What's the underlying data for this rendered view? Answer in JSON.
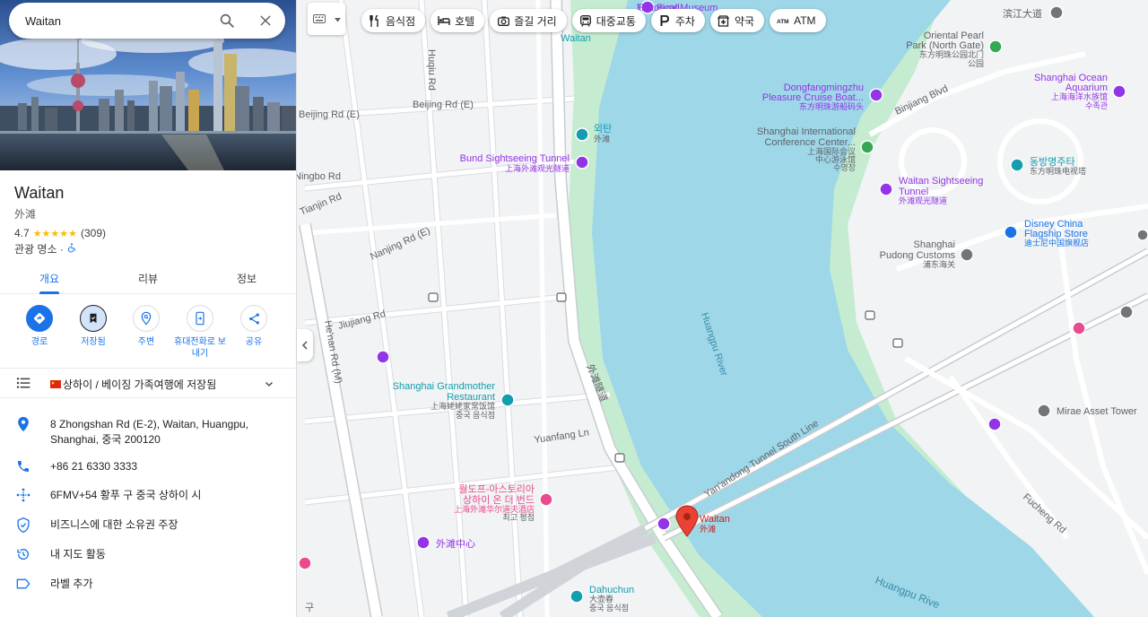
{
  "search": {
    "value": "Waitan"
  },
  "place": {
    "name": "Waitan",
    "local_name": "外滩",
    "rating": "4.7",
    "stars": "★★★★★",
    "review_count": "(309)",
    "category": "관광 명소 ·"
  },
  "tabs": [
    {
      "label": "개요"
    },
    {
      "label": "리뷰"
    },
    {
      "label": "정보"
    }
  ],
  "actions": [
    {
      "label": "경로"
    },
    {
      "label": "저장됨"
    },
    {
      "label": "주변"
    },
    {
      "label": "휴대전화로 보내기"
    },
    {
      "label": "공유"
    }
  ],
  "saved_list": {
    "label": "상하이 / 베이징 가족여행에 저장됨"
  },
  "info": {
    "address": "8 Zhongshan Rd (E-2), Waitan, Huangpu, Shanghai, 중국 200120",
    "phone": "+86 21 6330 3333",
    "plus_code": "6FMV+54 황푸 구 중국 상하이 시",
    "claim": "비즈니스에 대한 소유권 주장",
    "activity": "내 지도 활동",
    "label": "라벨 추가"
  },
  "chips": [
    {
      "label": "음식점",
      "icon": "restaurant-icon"
    },
    {
      "label": "호텔",
      "icon": "hotel-icon"
    },
    {
      "label": "즐길 거리",
      "icon": "camera-icon"
    },
    {
      "label": "대중교통",
      "icon": "transit-icon"
    },
    {
      "label": "주차",
      "icon": "parking-icon"
    },
    {
      "label": "약국",
      "icon": "pharmacy-icon"
    },
    {
      "label": "ATM",
      "icon": "atm-icon"
    }
  ],
  "map": {
    "river": "Huangpu River",
    "river_south": "Huangpu Rive",
    "tunnel_road": "Yan'andong Tunnel South Line",
    "bund_road": "外滩隧道",
    "roads": {
      "beijing_e_1": "Beijing Rd (E)",
      "beijing_e_2": "Beijing Rd (E)",
      "huqiu": "Huqiu Rd",
      "ningbo": "Ningbo Rd",
      "tianjin": "Tianjin Rd",
      "nanjing": "Nanjing Rd (E)",
      "jiujiang": "Jiujiang Rd",
      "henan": "He'nan Rd (M)",
      "yuanfang": "Yuanfang Ln",
      "binjiang": "Binjiang Blvd",
      "fucheng": "Fucheng Rd",
      "binjiang_ave": "滨江大道"
    },
    "pois": {
      "museum_1": "The Bund",
      "museum_2": "Historical Museum",
      "waitan_top": "Waitan",
      "waitan_stop_1": "외탄",
      "waitan_stop_2": "外滩",
      "tunnel_1": "Bund Sightseeing Tunnel",
      "tunnel_2": "上海外滩观光隧道",
      "pearl_1": "Oriental Pearl",
      "pearl_2": "Park (North Gate)",
      "pearl_3": "东方明珠公园北门",
      "pearl_4": "公园",
      "cruise_1": "Dongfangmingzhu",
      "cruise_2": "Pleasure Cruise Boat...",
      "cruise_3": "东方明珠游船码头",
      "aquarium_1": "Shanghai Ocean",
      "aquarium_2": "Aquarium",
      "aquarium_3": "上海海洋水族馆",
      "aquarium_4": "수족관",
      "conf_1": "Shanghai International",
      "conf_2": "Conference Center...",
      "conf_3": "上海国际会议",
      "conf_4": "中心游泳馆",
      "conf_5": "수영장",
      "tower_1": "동방명주타",
      "tower_2": "东方明珠电视塔",
      "wst_1": "Waitan Sightseeing",
      "wst_2": "Tunnel",
      "wst_3": "外滩观光隧道",
      "disney_1": "Disney China",
      "disney_2": "Flagship Store",
      "disney_3": "迪士尼中国旗舰店",
      "customs_1": "Shanghai",
      "customs_2": "Pudong Customs",
      "customs_3": "浦东海关",
      "grandmother_1": "Shanghai Grandmother",
      "grandmother_2": "Restaurant",
      "grandmother_3": "上海姥姥家常饭馆",
      "grandmother_4": "중국 음식점",
      "astoria_1": "월도프-아스토리아",
      "astoria_2": "상하이 온 더 번드",
      "astoria_3": "上海外滩华尔道夫酒店",
      "astoria_4": "최고 평점",
      "center": "外滩中心",
      "dahuchun_1": "Dahuchun",
      "dahuchun_2": "大壶春",
      "dahuchun_3": "중국 음식점",
      "mirae": "Mirae Asset Tower",
      "pin_1": "Waitan",
      "pin_2": "外滩",
      "edge": "구"
    }
  },
  "colors": {
    "accent": "#1a73e8",
    "water": "#9dd7e8",
    "park": "#c5ecd0",
    "poi_purple": "#9334e6",
    "poi_teal": "#129eaf",
    "pin_red": "#ea4335"
  }
}
